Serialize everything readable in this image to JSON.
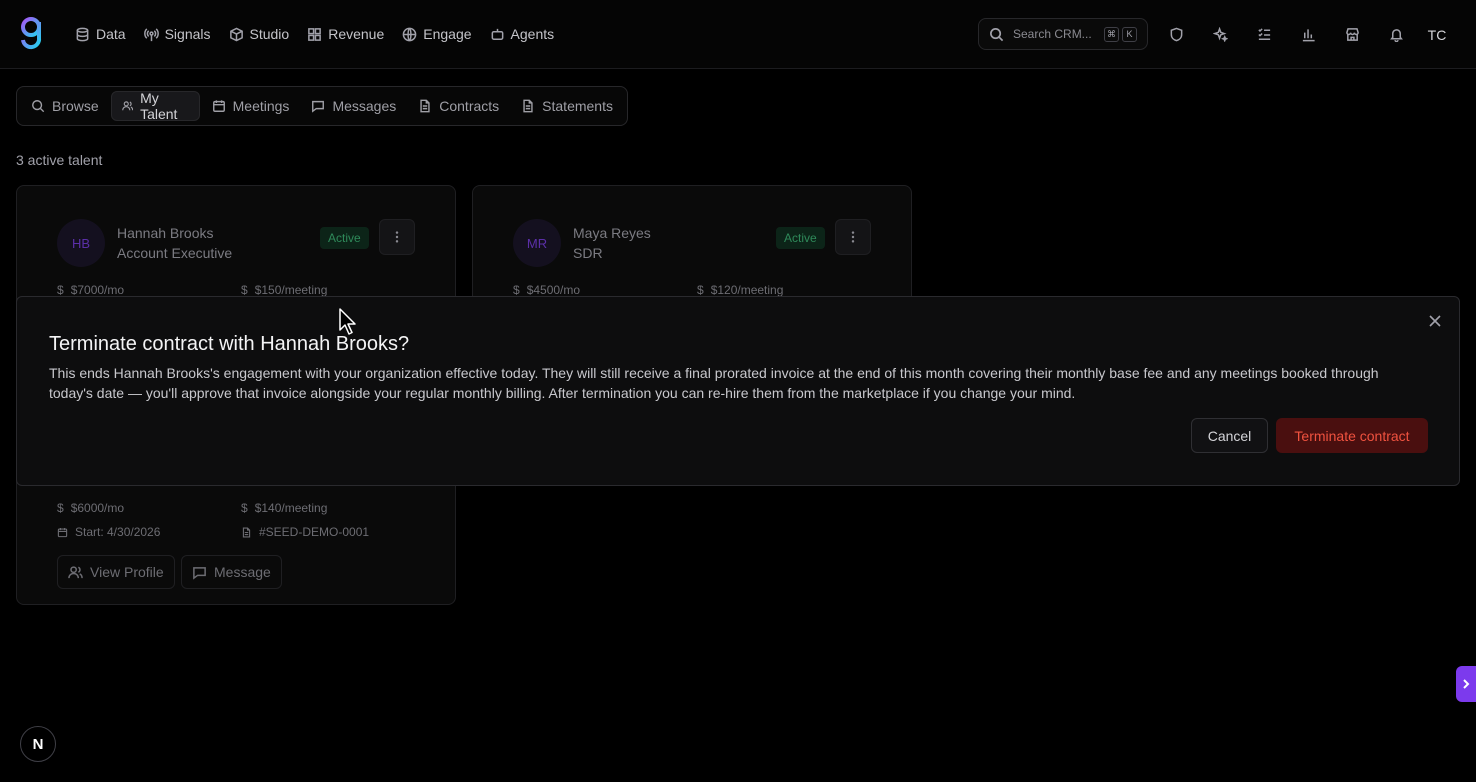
{
  "nav": {
    "items": [
      {
        "label": "Data",
        "icon": "database-icon"
      },
      {
        "label": "Signals",
        "icon": "radio-icon"
      },
      {
        "label": "Studio",
        "icon": "box-icon"
      },
      {
        "label": "Revenue",
        "icon": "grid-icon"
      },
      {
        "label": "Engage",
        "icon": "globe-icon"
      },
      {
        "label": "Agents",
        "icon": "bot-icon"
      }
    ],
    "search_placeholder": "Search CRM...",
    "shortcut_keys": [
      "⌘",
      "K"
    ],
    "user_initials": "TC"
  },
  "tabs": [
    {
      "label": "Browse",
      "icon": "search-icon"
    },
    {
      "label": "My Talent",
      "icon": "users-icon",
      "active": true
    },
    {
      "label": "Meetings",
      "icon": "calendar-icon"
    },
    {
      "label": "Messages",
      "icon": "message-icon"
    },
    {
      "label": "Contracts",
      "icon": "file-icon"
    },
    {
      "label": "Statements",
      "icon": "file-icon"
    }
  ],
  "count_label": "3 active talent",
  "cards": [
    {
      "initials": "HB",
      "name": "Hannah Brooks",
      "role": "Account Executive",
      "status": "Active",
      "monthly": "$7000/mo",
      "per_meeting": "$150/meeting"
    },
    {
      "initials": "MR",
      "name": "Maya Reyes",
      "role": "SDR",
      "status": "Active",
      "monthly": "$4500/mo",
      "per_meeting": "$120/meeting"
    },
    {
      "monthly": "$6000/mo",
      "per_meeting": "$140/meeting",
      "start": "Start: 4/30/2026",
      "contract_id": "#SEED-DEMO-0001",
      "view_profile": "View Profile",
      "message": "Message"
    }
  ],
  "modal": {
    "title": "Terminate contract with Hannah Brooks?",
    "body": "This ends Hannah Brooks's engagement with your organization effective today. They will still receive a final prorated invoice at the end of this month covering their monthly base fee and any meetings booked through today's date — you'll approve that invoice alongside your regular monthly billing. After termination you can re-hire them from the marketplace if you change your mind.",
    "cancel": "Cancel",
    "confirm": "Terminate contract",
    "confirm_color": "#f0523f"
  },
  "dev_badge": "N",
  "accent": "#7c3aed"
}
